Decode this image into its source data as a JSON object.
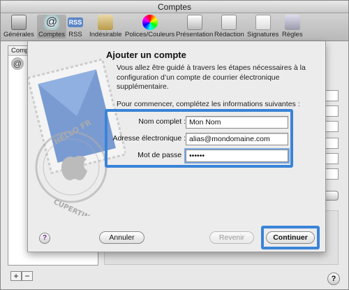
{
  "window": {
    "title": "Comptes"
  },
  "toolbar": {
    "items": [
      {
        "label": "Générales",
        "icon": "switch-icon"
      },
      {
        "label": "Comptes",
        "icon": "at-icon"
      },
      {
        "label": "RSS",
        "icon": "rss-icon"
      },
      {
        "label": "Indésirable",
        "icon": "junk-icon"
      },
      {
        "label": "Polices/Couleurs",
        "icon": "fonts-colors-icon"
      },
      {
        "label": "Présentation",
        "icon": "viewing-icon"
      },
      {
        "label": "Rédaction",
        "icon": "composing-icon"
      },
      {
        "label": "Signatures",
        "icon": "signature-icon"
      },
      {
        "label": "Règles",
        "icon": "rules-icon"
      }
    ],
    "selected_index": 1
  },
  "accounts": {
    "header": "Compte"
  },
  "sheet": {
    "title": "Ajouter un compte",
    "description": "Vous allez être guidé à travers les étapes nécessaires à la configuration d’un compte de courrier électronique supplémentaire.",
    "prompt": "Pour commencer, complétez les informations suivantes :",
    "fields": {
      "full_name": {
        "label": "Nom complet :",
        "value": "Mon Nom"
      },
      "email": {
        "label": "Adresse électronique :",
        "value": "alias@mondomaine.com"
      },
      "password": {
        "label": "Mot de passe :",
        "value": "••••••"
      }
    },
    "buttons": {
      "cancel": "Annuler",
      "back": "Revenir",
      "continue": "Continuer",
      "help": "?"
    },
    "stamp_text": "HELLO FR… CUPERTINO"
  },
  "bottom": {
    "add": "+",
    "remove": "−",
    "help": "?"
  },
  "colors": {
    "highlight": "#3a84d8"
  }
}
